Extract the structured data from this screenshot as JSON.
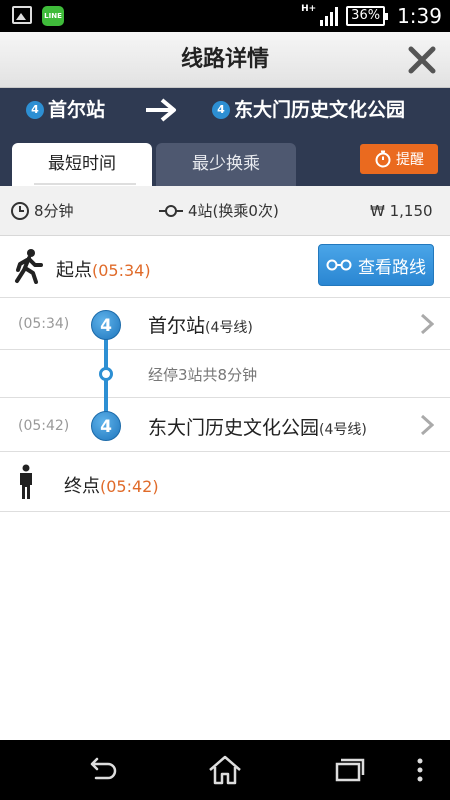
{
  "status_bar": {
    "network": "H+",
    "battery": "36%",
    "time": "1:39",
    "line_app_label": "LINE"
  },
  "header": {
    "title": "线路详情",
    "close_icon": "close-icon"
  },
  "route": {
    "from": {
      "line": "4",
      "name": "首尔站"
    },
    "to": {
      "line": "4",
      "name": "东大门历史文化公园"
    }
  },
  "tabs": [
    {
      "label": "最短时间",
      "active": true
    },
    {
      "label": "最少换乘",
      "active": false
    }
  ],
  "remind_button": {
    "label": "提醒",
    "icon": "stopwatch-icon"
  },
  "summary": {
    "duration": "8分钟",
    "stations": "4站(换乘0次)",
    "fare": "₩ 1,150"
  },
  "start": {
    "label": "起点",
    "time": "(05:34)",
    "view_route_label": "查看路线"
  },
  "stops": [
    {
      "time": "(05:34)",
      "line": "4",
      "name": "首尔站",
      "line_name": "(4号线)"
    },
    {
      "time": "(05:42)",
      "line": "4",
      "name": "东大门历史文化公园",
      "line_name": "(4号线)"
    }
  ],
  "transit_info": "经停3站共8分钟",
  "end": {
    "label": "终点",
    "time": "(05:42)"
  },
  "colors": {
    "route_bar": "#2f3a52",
    "line4": "#2d8fd3",
    "accent_orange": "#ea6a1f",
    "time_orange": "#e06b2a"
  }
}
